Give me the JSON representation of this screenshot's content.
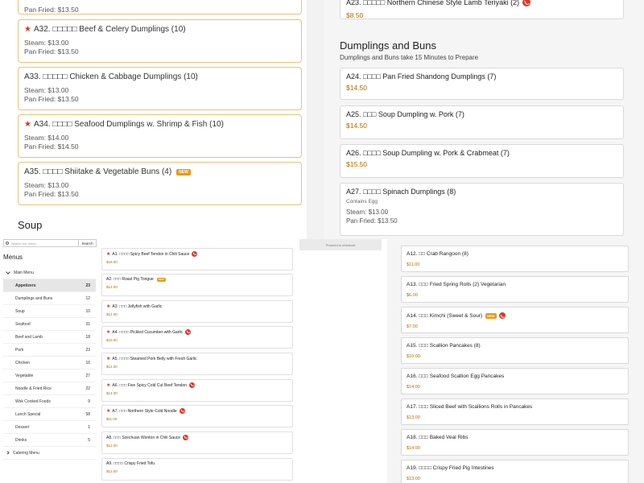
{
  "top_left": {
    "partial_pan_fried": "Pan Fried: $13.50",
    "cards": [
      {
        "code": "A32.",
        "name": "□□□□□ Beef & Celery Dumplings (10)",
        "starred": true,
        "steam": "Steam: $13.00",
        "pan": "Pan Fried: $13.50"
      },
      {
        "code": "A33.",
        "name": "□□□□□ Chicken & Cabbage Dumplings (10)",
        "starred": false,
        "steam": "Steam: $13.00",
        "pan": "Pan Fried: $13.50"
      },
      {
        "code": "A34.",
        "name": "□□□□ Seafood Dumplings w. Shrimp & Fish (10)",
        "starred": true,
        "steam": "Steam: $14.00",
        "pan": "Pan Fried: $14.50"
      },
      {
        "code": "A35.",
        "name": "□□□□ Shiitake & Vegetable Buns (4)",
        "starred": false,
        "new": true,
        "steam": "Steam: $13.00",
        "pan": "Pan Fried: $13.50"
      }
    ],
    "soup_heading": "Soup",
    "new_label": "NEW"
  },
  "top_right": {
    "partial_title": "A23. □□□□□ Northern Chinese Style Lamb Teriyaki (2)",
    "partial_price": "$8.50",
    "heading": "Dumplings and Buns",
    "subheading": "Dumplings and Buns take 15 Minutes to Prepare",
    "cards": [
      {
        "title": "A24. □□□□ Pan Fried Shandong Dumplings (7)",
        "price": "$14.50"
      },
      {
        "title": "A25. □□□ Soup Dumpling w. Pork (7)",
        "price": "$14.50"
      },
      {
        "title": "A26. □□□□ Soup Dumpling w. Pork & Crabmeat (7)",
        "price": "$15.50"
      },
      {
        "title": "A27. □□□□ Spinach Dumplings (8)",
        "contains": "Contains Egg",
        "steam": "Steam: $13.00",
        "pan": "Pan Fried: $13.50"
      }
    ]
  },
  "sidebar": {
    "search_placeholder": "Search our menu",
    "search_button": "Search",
    "menus_title": "Menus",
    "main_menu": "Main Menu",
    "items": [
      {
        "label": "Appetizers",
        "count": "23",
        "active": true
      },
      {
        "label": "Dumplings and Buns",
        "count": "12"
      },
      {
        "label": "Soup",
        "count": "10"
      },
      {
        "label": "Seafood",
        "count": "31"
      },
      {
        "label": "Beef and Lamb",
        "count": "18"
      },
      {
        "label": "Pork",
        "count": "23"
      },
      {
        "label": "Chicken",
        "count": "16"
      },
      {
        "label": "Vegetable",
        "count": "27"
      },
      {
        "label": "Noodle & Fried Rice",
        "count": "22"
      },
      {
        "label": "Wok Cooked Foods",
        "count": "9"
      },
      {
        "label": "Lunch Special",
        "count": "58"
      },
      {
        "label": "Dessert",
        "count": "1"
      },
      {
        "label": "Drinks",
        "count": "5"
      }
    ],
    "catering_menu": "Catering Menu"
  },
  "menu_items": [
    {
      "title": "A1. □□□□ Spicy Beef Tendon in Chili Sauce",
      "price": "$15.00",
      "star": true,
      "chili": true
    },
    {
      "title": "A2. □□□ Roast Pig Tongue",
      "price": "$12.00",
      "new": true
    },
    {
      "title": "A3. □□□ Jellyfish with Garlic",
      "price": "$12.00",
      "star": true
    },
    {
      "title": "A4. □□□□ Pickled Cucumber with Garlic",
      "price": "$10.00",
      "star": true,
      "chili": true
    },
    {
      "title": "A5. □□□□ Steamed Pork Belly with Fresh Garlic",
      "price": "$12.00",
      "star": true
    },
    {
      "title": "A6. □□□ Five Spicy Cold Cut Beef Tendon",
      "price": "$14.00",
      "star": true,
      "chili": true
    },
    {
      "title": "A7. □□□ Northern Style Cold Noodle",
      "price": "$11.00",
      "star": true,
      "chili": true
    },
    {
      "title": "A8. □□□ Szechuan Wonton in Chili Sauce",
      "price": "$12.00",
      "chili": true
    },
    {
      "title": "A9. □□□□ Crispy Fried Tofu",
      "price": "$12.00"
    }
  ],
  "checkout": "Proceed to checkout",
  "right_items": [
    {
      "title": "A12. □□ Crab Rangoon (8)",
      "price": "$11.00"
    },
    {
      "title": "A13. □□□ Fried Spring Rolls (2) Vegetarian",
      "price": "$6.00"
    },
    {
      "title": "A14. □□□ Kimchi (Sweet & Sour)",
      "price": "$7.00",
      "new": true,
      "chili": true
    },
    {
      "title": "A15. □□□ Scallion Pancakes (8)",
      "price": "$10.00"
    },
    {
      "title": "A16. □□□ Seafood Scallion Egg Pancakes",
      "price": "$14.00"
    },
    {
      "title": "A17. □□□ Sliced Beef with Scallions Rolls in Pancakes",
      "price": "$13.00"
    },
    {
      "title": "A18. □□□ Baked Veal Ribs",
      "price": "$14.00"
    },
    {
      "title": "A19. □□□□ Crispy Fried Pig Intestines",
      "price": "$13.00"
    }
  ]
}
